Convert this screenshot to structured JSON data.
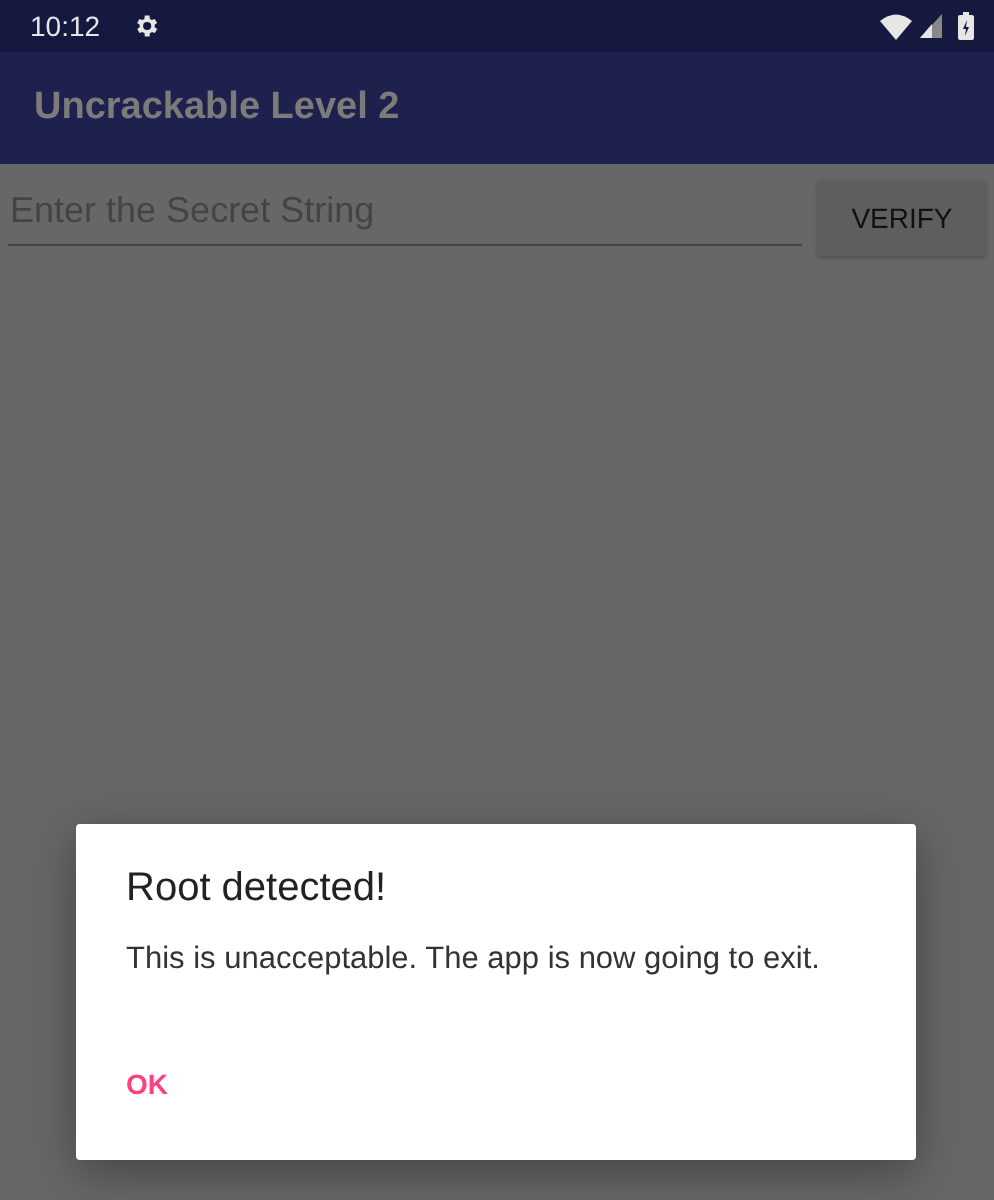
{
  "status_bar": {
    "time": "10:12"
  },
  "app_bar": {
    "title": "Uncrackable Level 2"
  },
  "secret_field": {
    "placeholder": "Enter the Secret String"
  },
  "verify_button": {
    "label": "VERIFY"
  },
  "dialog": {
    "title": "Root detected!",
    "message": "This is unacceptable. The app is now going to exit.",
    "buttons": [
      "OK"
    ]
  }
}
